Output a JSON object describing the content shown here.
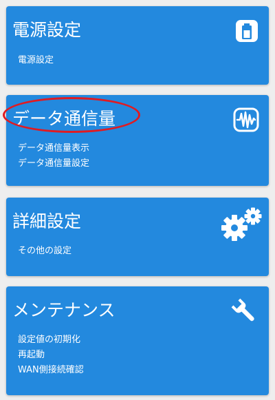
{
  "cards": [
    {
      "title": "電源設定",
      "links": [
        "電源設定"
      ],
      "icon": "battery-icon"
    },
    {
      "title": "データ通信量",
      "links": [
        "データ通信量表示",
        "データ通信量設定"
      ],
      "icon": "waveform-icon"
    },
    {
      "title": "詳細設定",
      "links": [
        "その他の設定"
      ],
      "icon": "gears-icon"
    },
    {
      "title": "メンテナンス",
      "links": [
        "設定値の初期化",
        "再起動",
        "WAN側接続確認"
      ],
      "icon": "wrench-icon"
    }
  ],
  "colors": {
    "card": "#2389de",
    "text": "#ffffff",
    "background": "#eeeeee",
    "highlight": "#e01b22"
  }
}
